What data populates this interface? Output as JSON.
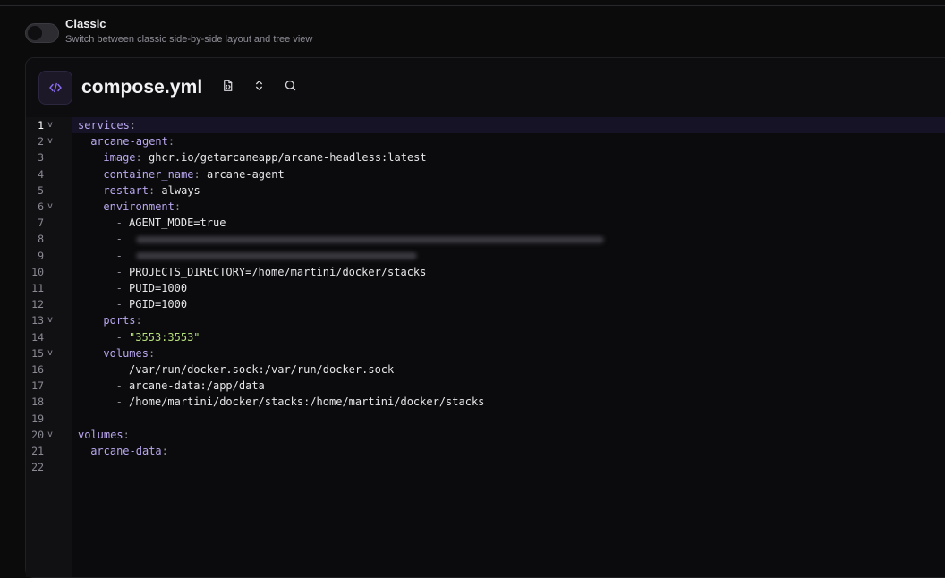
{
  "setting": {
    "title": "Classic",
    "description": "Switch between classic side-by-side layout and tree view",
    "enabled": false
  },
  "editor": {
    "filename": "compose.yml",
    "toolbar": {
      "format_icon": "file-code-icon",
      "fold_icon": "chevrons-up-down-icon",
      "search_icon": "search-icon"
    },
    "active_line": 1,
    "lines": [
      {
        "n": "1",
        "fold": true,
        "indent": 0,
        "key": "services",
        "dash": false,
        "value": "",
        "type": "key"
      },
      {
        "n": "2",
        "fold": true,
        "indent": 1,
        "key": "arcane-agent",
        "dash": false,
        "value": "",
        "type": "key"
      },
      {
        "n": "3",
        "fold": false,
        "indent": 2,
        "key": "image",
        "dash": false,
        "value": "ghcr.io/getarcaneapp/arcane-headless:latest",
        "type": "kv"
      },
      {
        "n": "4",
        "fold": false,
        "indent": 2,
        "key": "container_name",
        "dash": false,
        "value": "arcane-agent",
        "type": "kv"
      },
      {
        "n": "5",
        "fold": false,
        "indent": 2,
        "key": "restart",
        "dash": false,
        "value": "always",
        "type": "kv"
      },
      {
        "n": "6",
        "fold": true,
        "indent": 2,
        "key": "environment",
        "dash": false,
        "value": "",
        "type": "key"
      },
      {
        "n": "7",
        "fold": false,
        "indent": 3,
        "key": "",
        "dash": true,
        "value": "AGENT_MODE=true",
        "type": "item"
      },
      {
        "n": "8",
        "fold": false,
        "indent": 3,
        "key": "",
        "dash": true,
        "value": "",
        "type": "blurred",
        "blur_width": 0.55
      },
      {
        "n": "9",
        "fold": false,
        "indent": 3,
        "key": "",
        "dash": true,
        "value": "",
        "type": "blurred",
        "blur_width": 0.33
      },
      {
        "n": "10",
        "fold": false,
        "indent": 3,
        "key": "",
        "dash": true,
        "value": "PROJECTS_DIRECTORY=/home/martini/docker/stacks",
        "type": "item"
      },
      {
        "n": "11",
        "fold": false,
        "indent": 3,
        "key": "",
        "dash": true,
        "value": "PUID=1000",
        "type": "item"
      },
      {
        "n": "12",
        "fold": false,
        "indent": 3,
        "key": "",
        "dash": true,
        "value": "PGID=1000",
        "type": "item"
      },
      {
        "n": "13",
        "fold": true,
        "indent": 2,
        "key": "ports",
        "dash": false,
        "value": "",
        "type": "key"
      },
      {
        "n": "14",
        "fold": false,
        "indent": 3,
        "key": "",
        "dash": true,
        "value": "\"3553:3553\"",
        "type": "string"
      },
      {
        "n": "15",
        "fold": true,
        "indent": 2,
        "key": "volumes",
        "dash": false,
        "value": "",
        "type": "key"
      },
      {
        "n": "16",
        "fold": false,
        "indent": 3,
        "key": "",
        "dash": true,
        "value": "/var/run/docker.sock:/var/run/docker.sock",
        "type": "item"
      },
      {
        "n": "17",
        "fold": false,
        "indent": 3,
        "key": "",
        "dash": true,
        "value": "arcane-data:/app/data",
        "type": "item"
      },
      {
        "n": "18",
        "fold": false,
        "indent": 3,
        "key": "",
        "dash": true,
        "value": "/home/martini/docker/stacks:/home/martini/docker/stacks",
        "type": "item"
      },
      {
        "n": "19",
        "fold": false,
        "indent": 0,
        "key": "",
        "dash": false,
        "value": "",
        "type": "empty"
      },
      {
        "n": "20",
        "fold": true,
        "indent": 0,
        "key": "volumes",
        "dash": false,
        "value": "",
        "type": "key"
      },
      {
        "n": "21",
        "fold": false,
        "indent": 1,
        "key": "arcane-data",
        "dash": false,
        "value": "",
        "type": "key"
      },
      {
        "n": "22",
        "fold": false,
        "indent": 0,
        "key": "",
        "dash": false,
        "value": "",
        "type": "empty"
      }
    ]
  }
}
